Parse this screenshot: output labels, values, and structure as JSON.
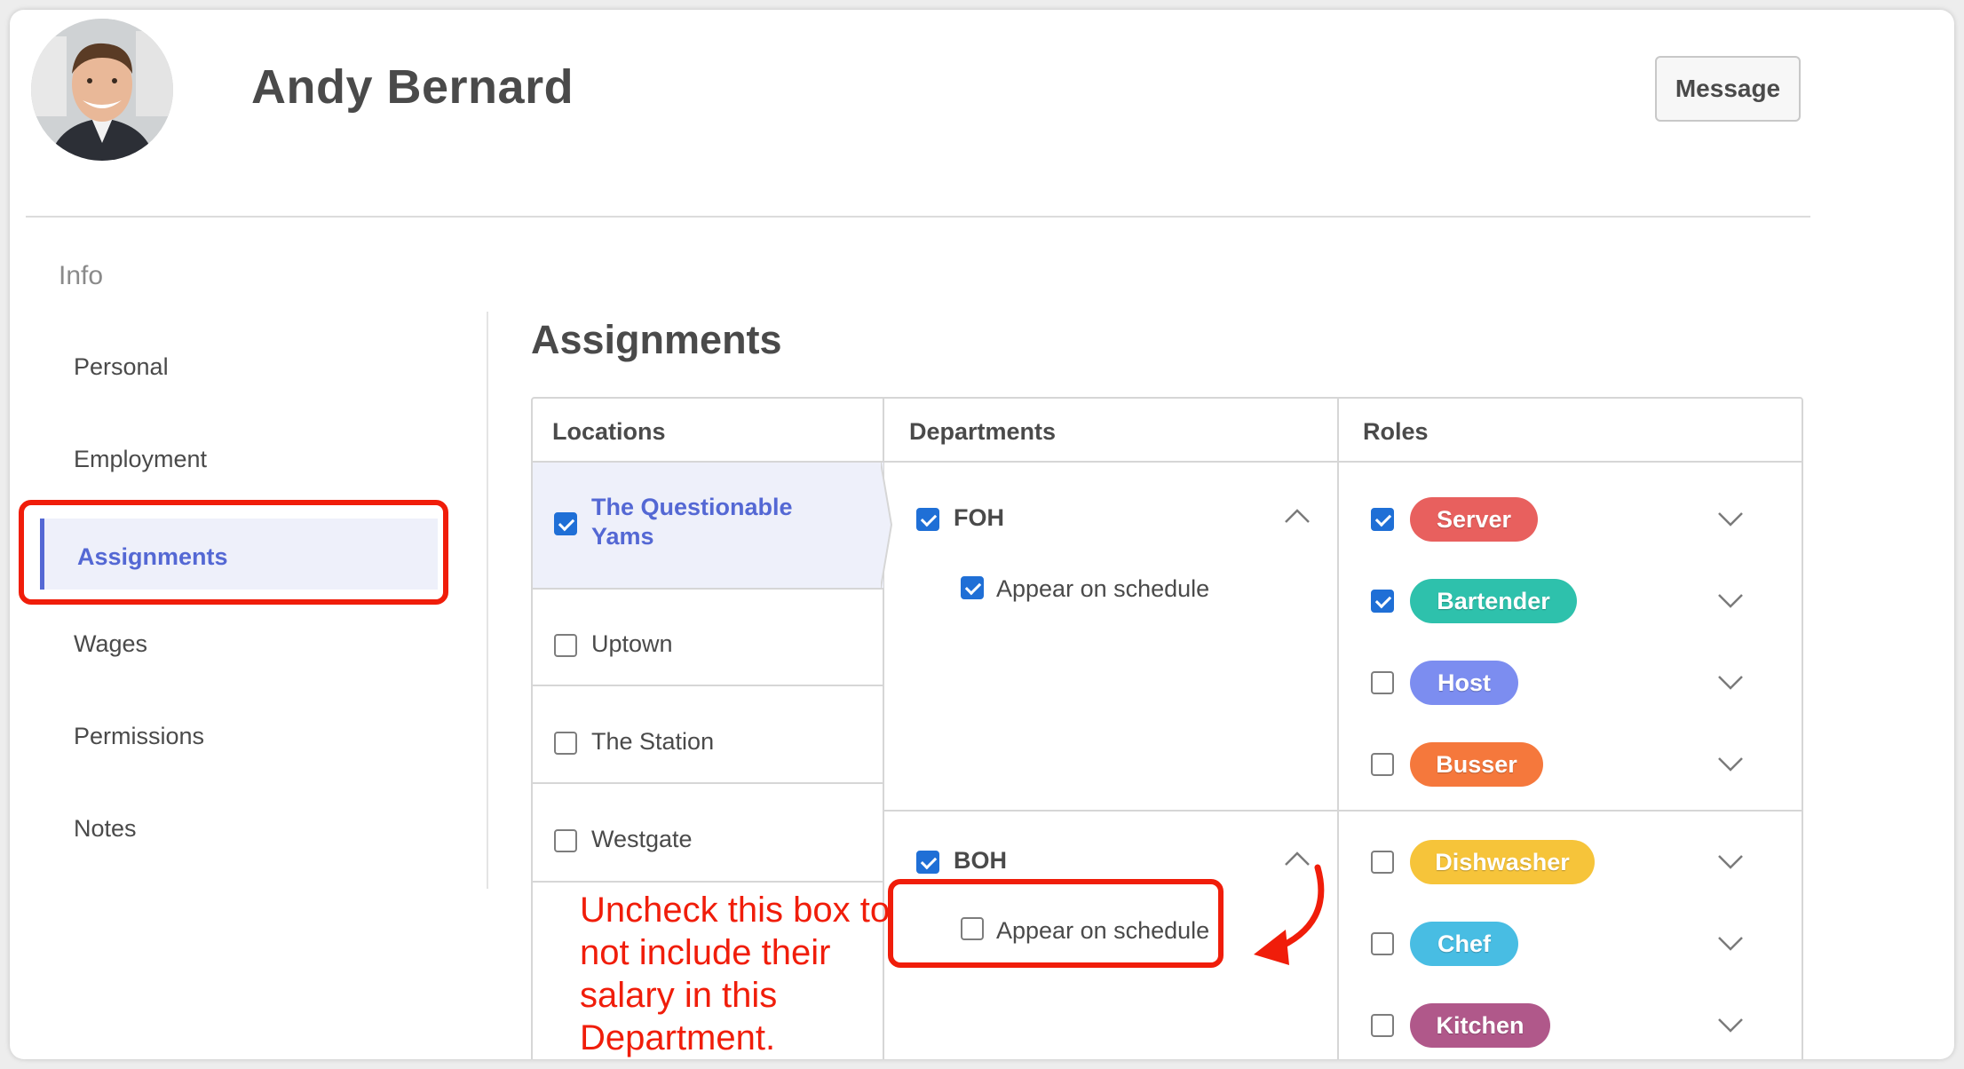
{
  "header": {
    "name": "Andy Bernard",
    "message_button": "Message"
  },
  "sidebar": {
    "heading": "Info",
    "items": [
      "Personal",
      "Employment",
      "Assignments",
      "Wages",
      "Permissions",
      "Notes"
    ],
    "active": "Assignments"
  },
  "section_title": "Assignments",
  "columns": {
    "locations": "Locations",
    "departments": "Departments",
    "roles": "Roles"
  },
  "locations": [
    {
      "name": "The Questionable Yams",
      "checked": true,
      "active": true
    },
    {
      "name": "Uptown",
      "checked": false
    },
    {
      "name": "The Station",
      "checked": false
    },
    {
      "name": "Westgate",
      "checked": false
    }
  ],
  "departments": [
    {
      "name": "FOH",
      "checked": true,
      "appear_on_schedule_label": "Appear on schedule",
      "appear_on_schedule": true
    },
    {
      "name": "BOH",
      "checked": true,
      "appear_on_schedule_label": "Appear on schedule",
      "appear_on_schedule": false
    }
  ],
  "roles": [
    {
      "name": "Server",
      "checked": true,
      "color": "#e8605e"
    },
    {
      "name": "Bartender",
      "checked": true,
      "color": "#2ec1ac"
    },
    {
      "name": "Host",
      "checked": false,
      "color": "#7c8df0"
    },
    {
      "name": "Busser",
      "checked": false,
      "color": "#f5783c"
    },
    {
      "name": "Dishwasher",
      "checked": false,
      "color": "#f6c43a"
    },
    {
      "name": "Chef",
      "checked": false,
      "color": "#48bde3"
    },
    {
      "name": "Kitchen",
      "checked": false,
      "color": "#b0588a"
    }
  ],
  "annotation": {
    "text": "Uncheck this box to not include their salary in this Department.",
    "color": "#f01d0a"
  },
  "colors": {
    "accent": "#5468d4",
    "checkbox": "#1f6fd6"
  }
}
